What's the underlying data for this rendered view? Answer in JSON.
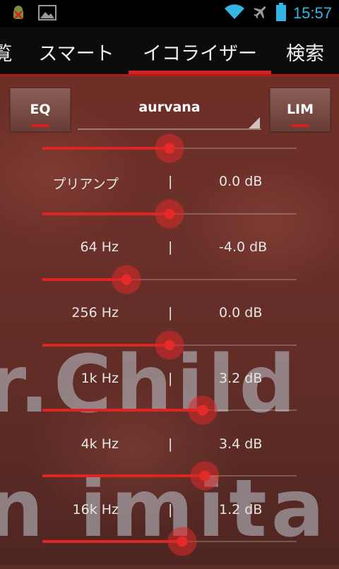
{
  "status_bar": {
    "time": "15:57",
    "icons": [
      "android-bug-icon",
      "image-icon",
      "wifi-icon",
      "airplane-icon",
      "battery-icon"
    ],
    "time_color": "#33b5e5"
  },
  "tabs": [
    {
      "label": "覧",
      "active": false
    },
    {
      "label": "スマート",
      "active": false
    },
    {
      "label": "イコライザー",
      "active": true
    },
    {
      "label": "検索",
      "active": false
    }
  ],
  "header": {
    "eq_label": "EQ",
    "preset_name": "aurvana",
    "lim_label": "LIM"
  },
  "bands": [
    {
      "label": "プリアンプ",
      "separator": "|",
      "value": "0.0 dB",
      "level": 0.5
    },
    {
      "label": "64 Hz",
      "separator": "|",
      "value": "-4.0 dB",
      "level": 0.33
    },
    {
      "label": "256 Hz",
      "separator": "|",
      "value": "0.0 dB",
      "level": 0.5
    },
    {
      "label": "1k Hz",
      "separator": "|",
      "value": "3.2 dB",
      "level": 0.63
    },
    {
      "label": "4k Hz",
      "separator": "|",
      "value": "3.4 dB",
      "level": 0.64
    },
    {
      "label": "16k Hz",
      "separator": "|",
      "value": "1.2 dB",
      "level": 0.55
    }
  ],
  "top_slider_level": 0.5,
  "background_art_text": [
    "r.Child",
    "n imita"
  ],
  "colors": {
    "accent": "#d32121",
    "tab_bg": "#0c0c0c"
  }
}
